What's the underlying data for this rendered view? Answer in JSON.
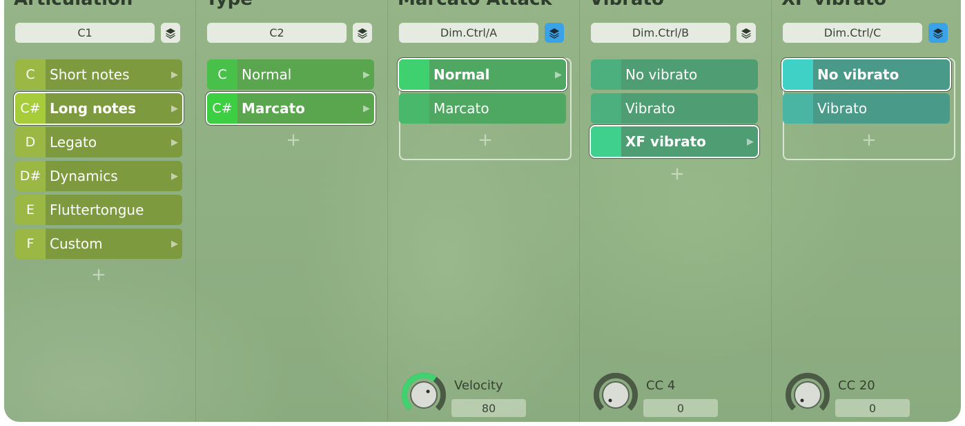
{
  "columns": [
    {
      "title": "Articulation",
      "selector": "C1",
      "items": [
        {
          "key": "C",
          "label": "Short notes"
        },
        {
          "key": "C#",
          "label": "Long notes"
        },
        {
          "key": "D",
          "label": "Legato"
        },
        {
          "key": "D#",
          "label": "Dynamics"
        },
        {
          "key": "E",
          "label": "Fluttertongue"
        },
        {
          "key": "F",
          "label": "Custom"
        }
      ],
      "add": "+"
    },
    {
      "title": "Type",
      "selector": "C2",
      "items": [
        {
          "key": "C",
          "label": "Normal"
        },
        {
          "key": "C#",
          "label": "Marcato"
        }
      ],
      "add": "+"
    },
    {
      "title": "Marcato Attack",
      "selector": "Dim.Ctrl/A",
      "items": [
        {
          "label": "Normal"
        },
        {
          "label": "Marcato"
        }
      ],
      "add": "+",
      "knob": {
        "label": "Velocity",
        "value": "80"
      }
    },
    {
      "title": "Vibrato",
      "selector": "Dim.Ctrl/B",
      "items": [
        {
          "label": "No vibrato"
        },
        {
          "label": "Vibrato"
        },
        {
          "label": "XF vibrato"
        }
      ],
      "add": "+",
      "knob": {
        "label": "CC 4",
        "value": "0"
      }
    },
    {
      "title": "XF vibrato",
      "selector": "Dim.Ctrl/C",
      "items": [
        {
          "label": "No vibrato"
        },
        {
          "label": "Vibrato"
        }
      ],
      "add": "+",
      "knob": {
        "label": "CC 20",
        "value": "0"
      }
    }
  ],
  "icons": {
    "layers": "layers-icon",
    "arrow": "chevron-right-icon",
    "knob": "knob-icon"
  },
  "colors": {
    "olive": "#7e9a3f",
    "olive_key": "#9ab843",
    "green": "#5aa64f",
    "green_key": "#49c04a",
    "teal_green": "#4c9f6c",
    "teal_green_key": "#3ec77c",
    "teal": "#4a9a8a",
    "teal_key": "#3fd0c6",
    "accent_blue": "#3aa3e8"
  }
}
